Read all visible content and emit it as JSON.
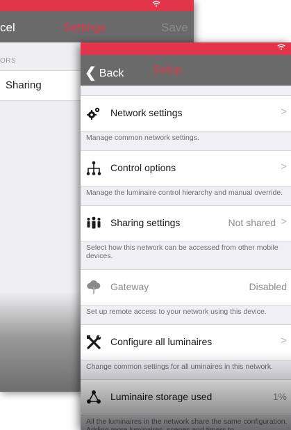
{
  "background_screen": {
    "nav": {
      "cancel_label": "cel",
      "title": "Settings",
      "save_label": "Save"
    },
    "section_label": "ORS",
    "row_label": "Sharing"
  },
  "setup": {
    "nav": {
      "back_label": "Back",
      "title": "Setup"
    },
    "items": [
      {
        "label": "Network settings",
        "value": "",
        "icon": "gears-icon",
        "description": "Manage common network settings."
      },
      {
        "label": "Control options",
        "value": "",
        "icon": "hierarchy-icon",
        "description": "Manage the luminaire control hierarchy and manual override."
      },
      {
        "label": "Sharing settings",
        "value": "Not shared",
        "icon": "people-icon",
        "description": "Select how this network can be accessed from other mobile devices."
      },
      {
        "label": "Gateway",
        "value": "Disabled",
        "icon": "cloud-upload-icon",
        "description": "Set up remote access to your network using this device."
      },
      {
        "label": "Configure all luminaires",
        "value": "",
        "icon": "tools-icon",
        "description": "Change common settings for all uminaires in this network."
      },
      {
        "label": "Luminaire storage used",
        "value": "1%",
        "icon": "network-nodes-icon",
        "description": "All the luminaires in the network share the same configuration. Adding more luminaires, scenes and timers to"
      }
    ],
    "chevron": ">"
  }
}
